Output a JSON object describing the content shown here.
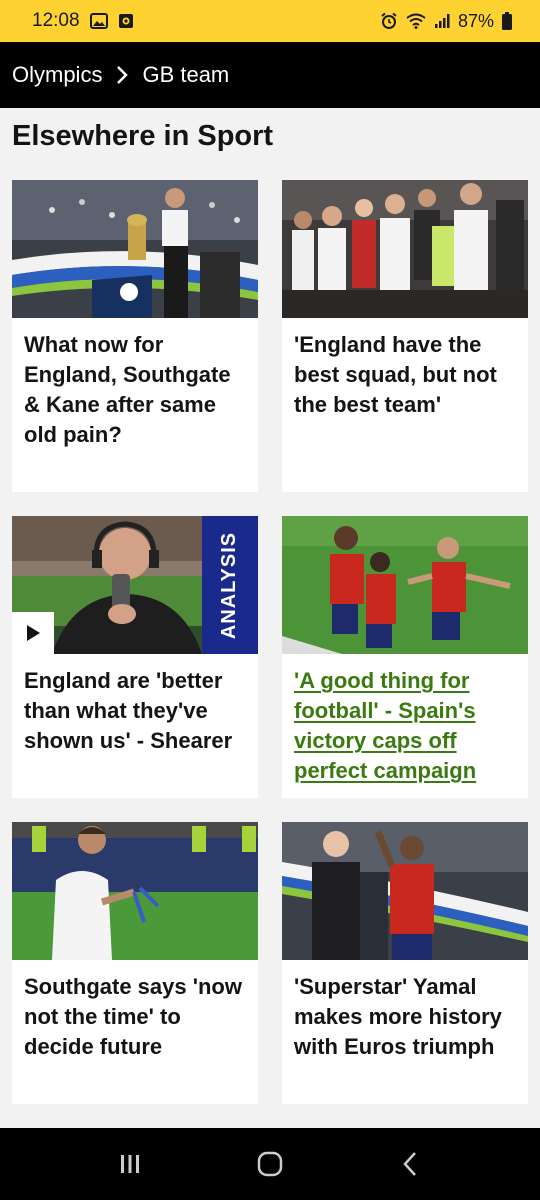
{
  "status": {
    "time": "12:08",
    "battery": "87%"
  },
  "breadcrumb": {
    "parent": "Olympics",
    "current": "GB team"
  },
  "section": {
    "title": "Elsewhere in Sport"
  },
  "cards": [
    {
      "headline": "What now for England, Southgate & Kane after same old pain?"
    },
    {
      "headline": "'England have the best squad, but not the best team'"
    },
    {
      "headline": "England are 'better than what they've shown us' - Shearer",
      "tag": "ANALYSIS"
    },
    {
      "headline": "'A good thing for football' - Spain's victory caps off perfect campaign"
    },
    {
      "headline": "Southgate says 'now not the time' to decide future"
    },
    {
      "headline": "'Superstar' Yamal makes more history with Euros triumph"
    }
  ],
  "colors": {
    "status_bar": "#fed230",
    "link_visited": "#3a7a10",
    "analysis_tag": "#1a2a8c"
  },
  "icons": {
    "status_left": [
      "gallery-icon",
      "screen-record-icon"
    ],
    "status_right": [
      "alarm-icon",
      "wifi-icon",
      "signal-icon",
      "battery-icon"
    ],
    "breadcrumb_separator": "chevron-right-icon",
    "video": "play-icon",
    "system_nav": [
      "recent-apps-icon",
      "home-icon",
      "back-icon"
    ]
  }
}
